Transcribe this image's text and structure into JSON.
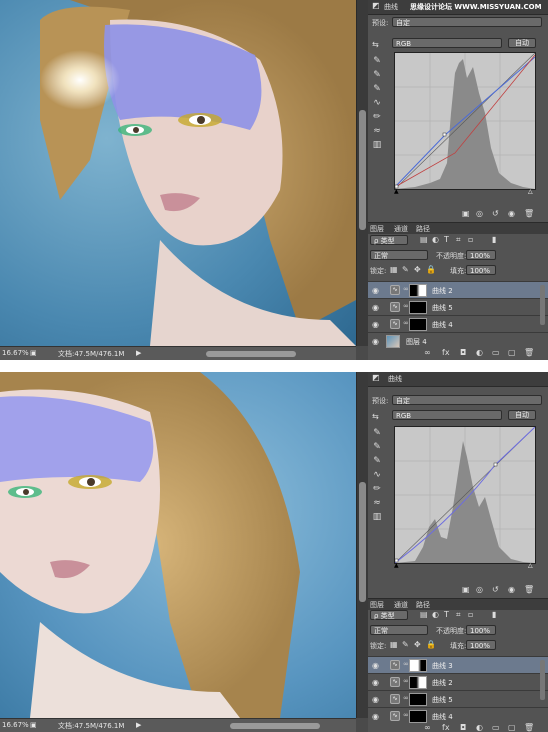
{
  "shot1": {
    "properties_tab": "曲线",
    "watermark": "思缘设计论坛 WWW.MISSYUAN.COM",
    "preset_label": "预设:",
    "preset_value": "自定",
    "channel": "RGB",
    "auto_button": "自动",
    "layer_tabs": [
      "图层",
      "通道",
      "路径"
    ],
    "kind_filter": "类型",
    "blend_mode": "正常",
    "opacity_label": "不透明度:",
    "opacity_value": "100%",
    "lock_label": "锁定:",
    "fill_label": "填充:",
    "fill_value": "100%",
    "layers": [
      {
        "name": "曲线 2",
        "selected": true
      },
      {
        "name": "曲线 5",
        "selected": false
      },
      {
        "name": "曲线 4",
        "selected": false
      },
      {
        "name": "图层 4",
        "selected": false
      }
    ],
    "zoom": "16.67%",
    "doc_info": "文档:47.5M/476.1M"
  },
  "shot2": {
    "properties_tab": "曲线",
    "preset_label": "预设:",
    "preset_value": "自定",
    "channel": "RGB",
    "auto_button": "自动",
    "layer_tabs": [
      "图层",
      "通道",
      "路径"
    ],
    "kind_filter": "类型",
    "blend_mode": "正常",
    "opacity_label": "不透明度:",
    "opacity_value": "100%",
    "lock_label": "锁定:",
    "fill_label": "填充:",
    "fill_value": "100%",
    "layers": [
      {
        "name": "曲线 3",
        "selected": true
      },
      {
        "name": "曲线 2",
        "selected": false
      },
      {
        "name": "曲线 5",
        "selected": false
      },
      {
        "name": "曲线 4",
        "selected": false
      }
    ],
    "zoom": "16.67%",
    "doc_info": "文档:47.5M/476.1M"
  },
  "icons": {
    "tools": [
      "eyedropper-icon",
      "eyedropper-black-icon",
      "eyedropper-gray-icon",
      "eyedropper-white-icon",
      "curve-edit-icon",
      "pencil-icon",
      "smooth-icon",
      "clip-icon"
    ],
    "layer_eye": "eye-icon"
  },
  "colors": {
    "panel_bg": "#535353",
    "selected_layer": "#6c7a8e",
    "histogram": "#8a8a8a",
    "graph_bg": "#c8c8c8"
  }
}
